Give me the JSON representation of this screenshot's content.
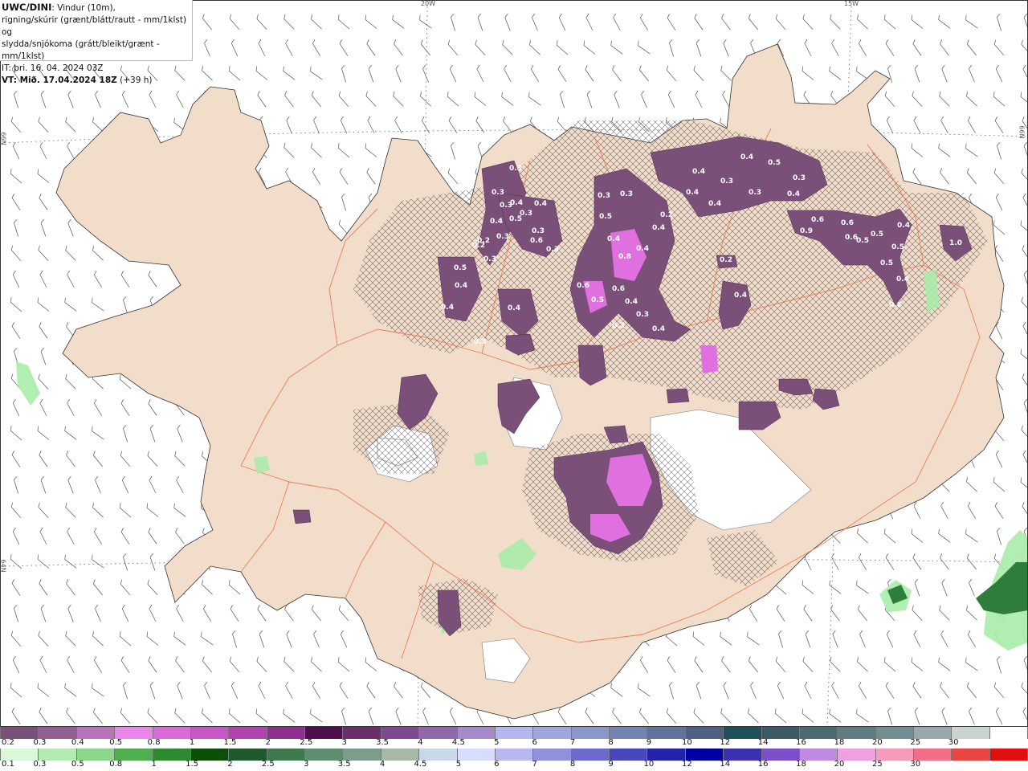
{
  "header": {
    "model": "UWC/DINI",
    "line1_rest": ": Vindur (10m),",
    "line2": "rigning/skúrir (grænt/blátt/rautt - mm/1klst) og",
    "line3": "slydda/snjókoma (grátt/bleikt/grænt - mm/1klst)",
    "it_line": "IT: þri. 16. 04. 2024 03Z",
    "vt_bold": "VT: Mið. 17.04.2024 18Z",
    "vt_rest": " (+39 h)"
  },
  "grid_labels": {
    "lon_20w": "20W",
    "lon_15w": "15W",
    "lat_66n_left": "66N",
    "lat_66n_right": "66N",
    "lat_64n_left": "64N"
  },
  "precip_labels": [
    "0.3",
    "0.3",
    "0.3",
    "0.4",
    "0.5",
    "0.3",
    "0.4",
    "0.2",
    "0.3",
    "0.4",
    "0.3",
    "0.3",
    "0.3",
    "0.5",
    "0.4",
    "0.2",
    "0.4",
    "0.3",
    "0.4",
    "0.6",
    "0.8",
    "0.6",
    "0.5",
    "0.6",
    "0.4",
    "0.4",
    "0.4",
    "0.5",
    "0.3",
    "0.3",
    "0.4",
    "0.2",
    "0.3",
    "0.2",
    "0.4",
    "0.4",
    "0.4",
    "0.3",
    "0.3",
    "0.4",
    "0.5",
    "0.3",
    "0.4",
    "0.4",
    "0.6",
    "0.9",
    "0.6",
    "0.6",
    "0.5",
    "0.5",
    "0.4",
    "0.5",
    "0.5",
    "0.4",
    "1.0",
    "0.8",
    "0.2",
    "0.4"
  ],
  "legend": {
    "snow": {
      "labels": [
        "0.2",
        "0.3",
        "0.4",
        "0.5",
        "0.8",
        "1",
        "1.5",
        "2",
        "2.5",
        "3",
        "3.5",
        "4",
        "4.5",
        "5",
        "6",
        "7",
        "8",
        "9",
        "10",
        "12",
        "14",
        "16",
        "18",
        "20",
        "25",
        "30"
      ],
      "colors": [
        "#7a4f78",
        "#915f93",
        "#b774b8",
        "#ea86ea",
        "#d96ad9",
        "#c756c7",
        "#b043b0",
        "#8f2f8f",
        "#4f0f4f",
        "#6a2f6a",
        "#7e4990",
        "#9069aa",
        "#a48ac8",
        "#b6b6ef",
        "#9fa5dd",
        "#8a98c9",
        "#7284b2",
        "#61739c",
        "#505f86",
        "#1f4f5b",
        "#3c5a62",
        "#4a6b70",
        "#5e7d80",
        "#718e90",
        "#99a9ab",
        "#c9d3d4",
        "#ffffff"
      ]
    },
    "rain": {
      "labels": [
        "0.1",
        "0.3",
        "0.5",
        "0.8",
        "1",
        "1.5",
        "2",
        "2.5",
        "3",
        "3.5",
        "4",
        "4.5",
        "5",
        "6",
        "7",
        "8",
        "9",
        "10",
        "12",
        "14",
        "16",
        "18",
        "20",
        "25",
        "30"
      ],
      "colors": [
        "#d9f7d9",
        "#b4eab4",
        "#8cd68c",
        "#4fae4f",
        "#2e8a2e",
        "#0b4f0b",
        "#1f5a2f",
        "#3f7a4f",
        "#5e8d6f",
        "#7a9e8a",
        "#a6b9a6",
        "#c8d8e8",
        "#d8dcff",
        "#b8b8ee",
        "#9090dd",
        "#6c6ccc",
        "#4848bb",
        "#2222aa",
        "#0000a0",
        "#3a30b0",
        "#7a50c8",
        "#c08ae0",
        "#f0a0e0",
        "#f59bbb",
        "#f06e88",
        "#e84545",
        "#e01010"
      ]
    }
  }
}
